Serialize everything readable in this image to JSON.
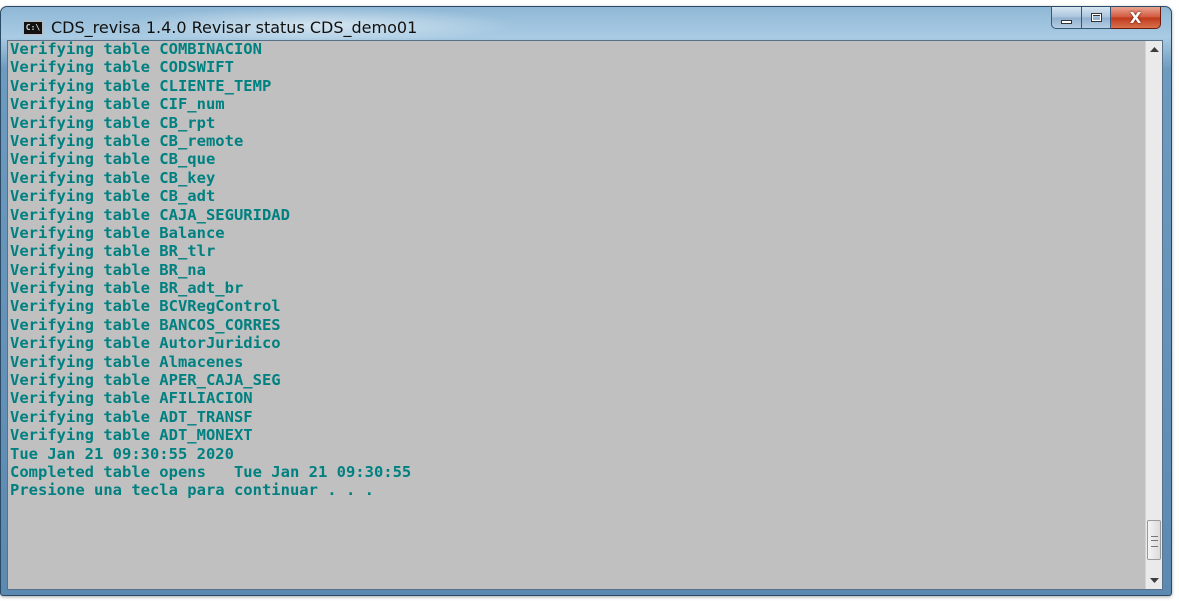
{
  "window": {
    "title": "CDS_revisa 1.4.0 Revisar status CDS_demo01",
    "icon_text": "C:\\",
    "close_glyph": "X"
  },
  "console": {
    "lines": [
      "Verifying table COMBINACION",
      "Verifying table CODSWIFT",
      "Verifying table CLIENTE_TEMP",
      "Verifying table CIF_num",
      "Verifying table CB_rpt",
      "Verifying table CB_remote",
      "Verifying table CB_que",
      "Verifying table CB_key",
      "Verifying table CB_adt",
      "Verifying table CAJA_SEGURIDAD",
      "Verifying table Balance",
      "Verifying table BR_tlr",
      "Verifying table BR_na",
      "Verifying table BR_adt_br",
      "Verifying table BCVRegControl",
      "Verifying table BANCOS_CORRES",
      "Verifying table AutorJuridico",
      "Verifying table Almacenes",
      "Verifying table APER_CAJA_SEG",
      "Verifying table AFILIACION",
      "Verifying table ADT_TRANSF",
      "Verifying table ADT_MONEXT",
      "Tue Jan 21 09:30:55 2020",
      "Completed table opens   Tue Jan 21 09:30:55",
      "Presione una tecla para continuar . . ."
    ],
    "text_color": "#008080",
    "background": "#c0c0c0"
  }
}
